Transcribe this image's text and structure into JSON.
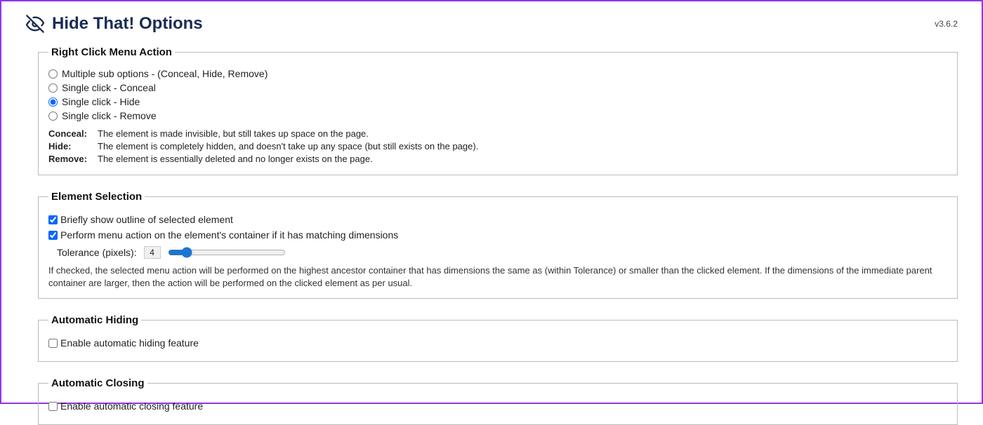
{
  "header": {
    "title": "Hide That! Options",
    "version": "v3.6.2"
  },
  "rightClickMenu": {
    "legend": "Right Click Menu Action",
    "options": {
      "multi": "Multiple sub options - (Conceal, Hide, Remove)",
      "conceal": "Single click - Conceal",
      "hide": "Single click - Hide",
      "remove": "Single click - Remove"
    },
    "selected": "hide",
    "defs": {
      "conceal_term": "Conceal:",
      "conceal_desc": "The element is made invisible, but still takes up space on the page.",
      "hide_term": "Hide:",
      "hide_desc": "The element is completely hidden, and doesn't take up any space (but still exists on the page).",
      "remove_term": "Remove:",
      "remove_desc": "The element is essentially deleted and no longer exists on the page."
    }
  },
  "elementSelection": {
    "legend": "Element Selection",
    "outline_label": "Briefly show outline of selected element",
    "container_label": "Perform menu action on the element's container if it has matching dimensions",
    "tolerance_label": "Tolerance (pixels):",
    "tolerance_value": "4",
    "help": "If checked, the selected menu action will be performed on the highest ancestor container that has dimensions the same as (within Tolerance) or smaller than the clicked element. If the dimensions of the immediate parent container are larger, then the action will be performed on the clicked element as per usual."
  },
  "autoHiding": {
    "legend": "Automatic Hiding",
    "enable_label": "Enable automatic hiding feature"
  },
  "autoClosing": {
    "legend": "Automatic Closing",
    "enable_label": "Enable automatic closing feature"
  }
}
